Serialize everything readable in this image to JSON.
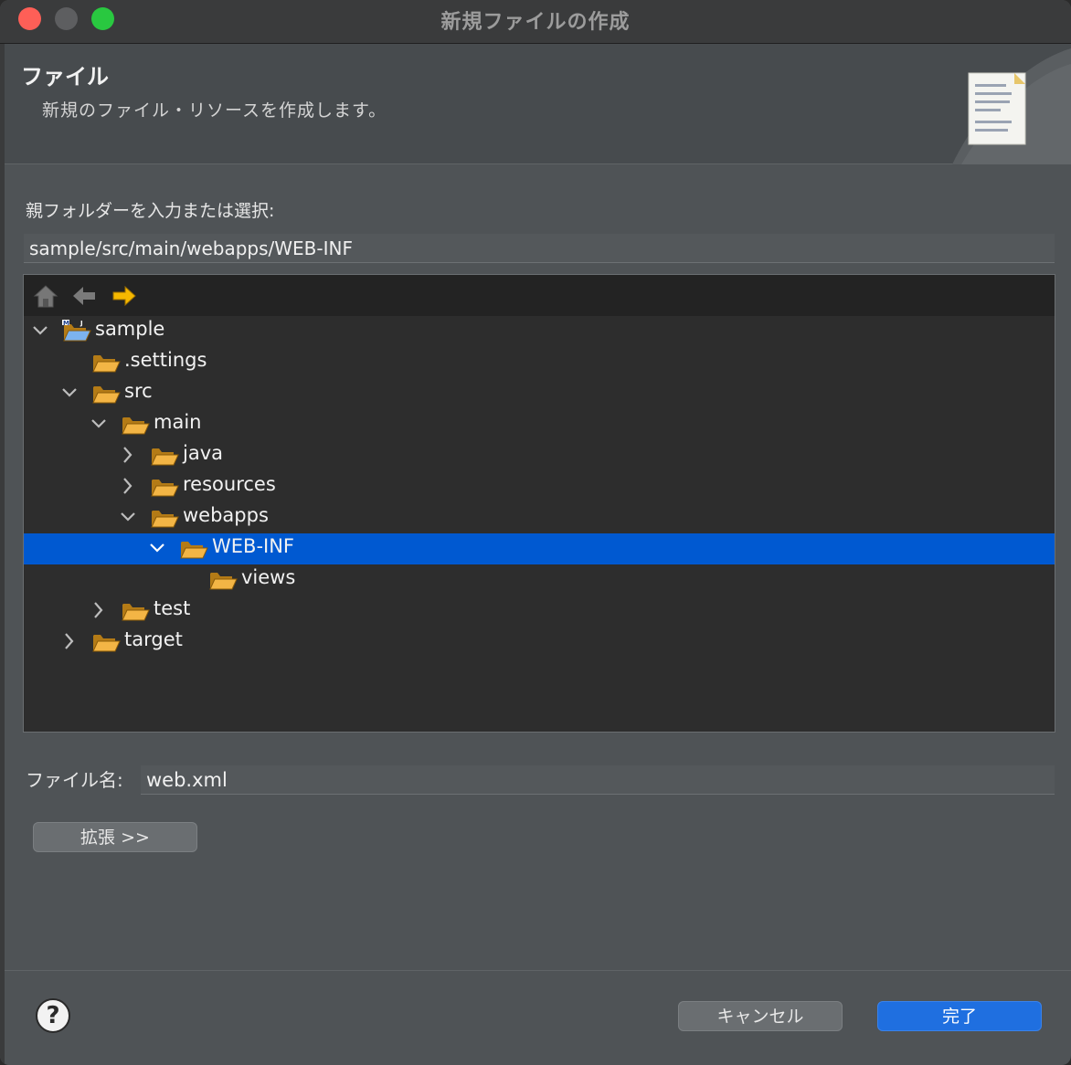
{
  "window": {
    "title": "新規ファイルの作成"
  },
  "header": {
    "title": "ファイル",
    "description": "新規のファイル・リソースを作成します。"
  },
  "parent": {
    "label": "親フォルダーを入力または選択:",
    "value": "sample/src/main/webapps/WEB-INF"
  },
  "tree": {
    "toolbar": [
      "home-icon",
      "back-arrow-icon",
      "forward-arrow-icon"
    ],
    "items": [
      {
        "label": "sample",
        "depth": 0,
        "state": "expanded",
        "icon": "project-folder-icon"
      },
      {
        "label": ".settings",
        "depth": 1,
        "state": "leaf",
        "icon": "folder-icon"
      },
      {
        "label": "src",
        "depth": 1,
        "state": "expanded",
        "icon": "folder-icon"
      },
      {
        "label": "main",
        "depth": 2,
        "state": "expanded",
        "icon": "folder-icon"
      },
      {
        "label": "java",
        "depth": 3,
        "state": "collapsed",
        "icon": "folder-icon"
      },
      {
        "label": "resources",
        "depth": 3,
        "state": "collapsed",
        "icon": "folder-icon"
      },
      {
        "label": "webapps",
        "depth": 3,
        "state": "expanded",
        "icon": "folder-icon"
      },
      {
        "label": "WEB-INF",
        "depth": 4,
        "state": "expanded",
        "icon": "folder-icon",
        "selected": true
      },
      {
        "label": "views",
        "depth": 5,
        "state": "leaf",
        "icon": "folder-icon"
      },
      {
        "label": "test",
        "depth": 2,
        "state": "collapsed",
        "icon": "folder-icon"
      },
      {
        "label": "target",
        "depth": 1,
        "state": "collapsed",
        "icon": "folder-icon"
      }
    ]
  },
  "filename": {
    "label": "ファイル名:",
    "value": "web.xml"
  },
  "buttons": {
    "advanced": "拡張 >>",
    "cancel": "キャンセル",
    "finish": "完了",
    "help": "?"
  },
  "colors": {
    "selection": "#0059d1",
    "primary_button": "#1f6fe0",
    "folder": "#f3b545"
  }
}
